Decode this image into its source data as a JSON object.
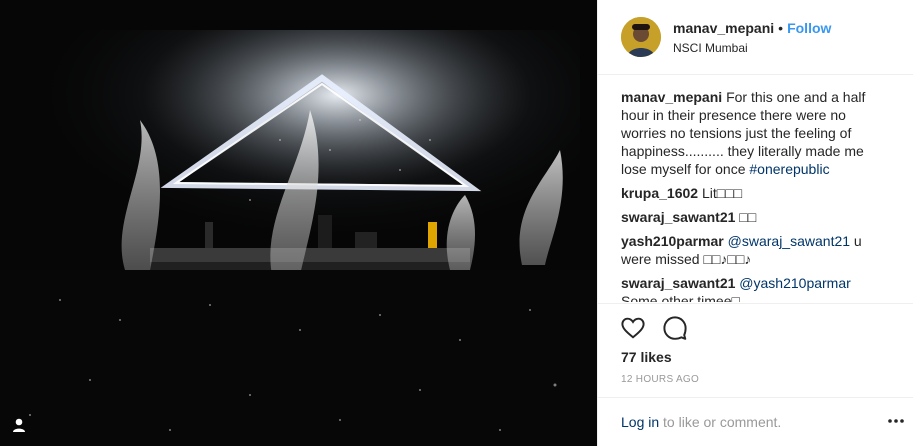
{
  "post": {
    "username": "manav_mepani",
    "separator": "•",
    "follow_label": "Follow",
    "location": "NSCI Mumbai"
  },
  "comments": [
    {
      "user": "manav_mepani",
      "parts": [
        {
          "text": "For this one and a half hour in their presence there were no worries no tensions just the feeling of happiness.......... they literally made me lose myself for once ",
          "link": false
        },
        {
          "text": "#onerepublic",
          "link": true
        }
      ]
    },
    {
      "user": "krupa_1602",
      "parts": [
        {
          "text": "Lit□□□",
          "link": false
        }
      ]
    },
    {
      "user": "swaraj_sawant21",
      "parts": [
        {
          "text": "□□",
          "link": false
        }
      ]
    },
    {
      "user": "yash210parmar",
      "parts": [
        {
          "text": "@swaraj_sawant21",
          "link": true
        },
        {
          "text": " u were missed □□♪□□♪",
          "link": false
        }
      ]
    },
    {
      "user": "swaraj_sawant21",
      "parts": [
        {
          "text": "@yash210parmar",
          "link": true
        },
        {
          "text": " Some other timee□",
          "link": false
        }
      ]
    }
  ],
  "actions": {
    "like_icon": "heart-outline-icon",
    "comment_icon": "speech-bubble-icon"
  },
  "likes_text": "77 likes",
  "time_text": "12 HOURS AGO",
  "login": {
    "link_label": "Log in",
    "suffix": " to like or comment."
  },
  "icons": {
    "tag": "user-tag-icon",
    "more": "more-dots-icon"
  },
  "colors": {
    "link": "#3897f0",
    "dark_link": "#003569",
    "muted": "#999999",
    "border": "#efefef"
  }
}
